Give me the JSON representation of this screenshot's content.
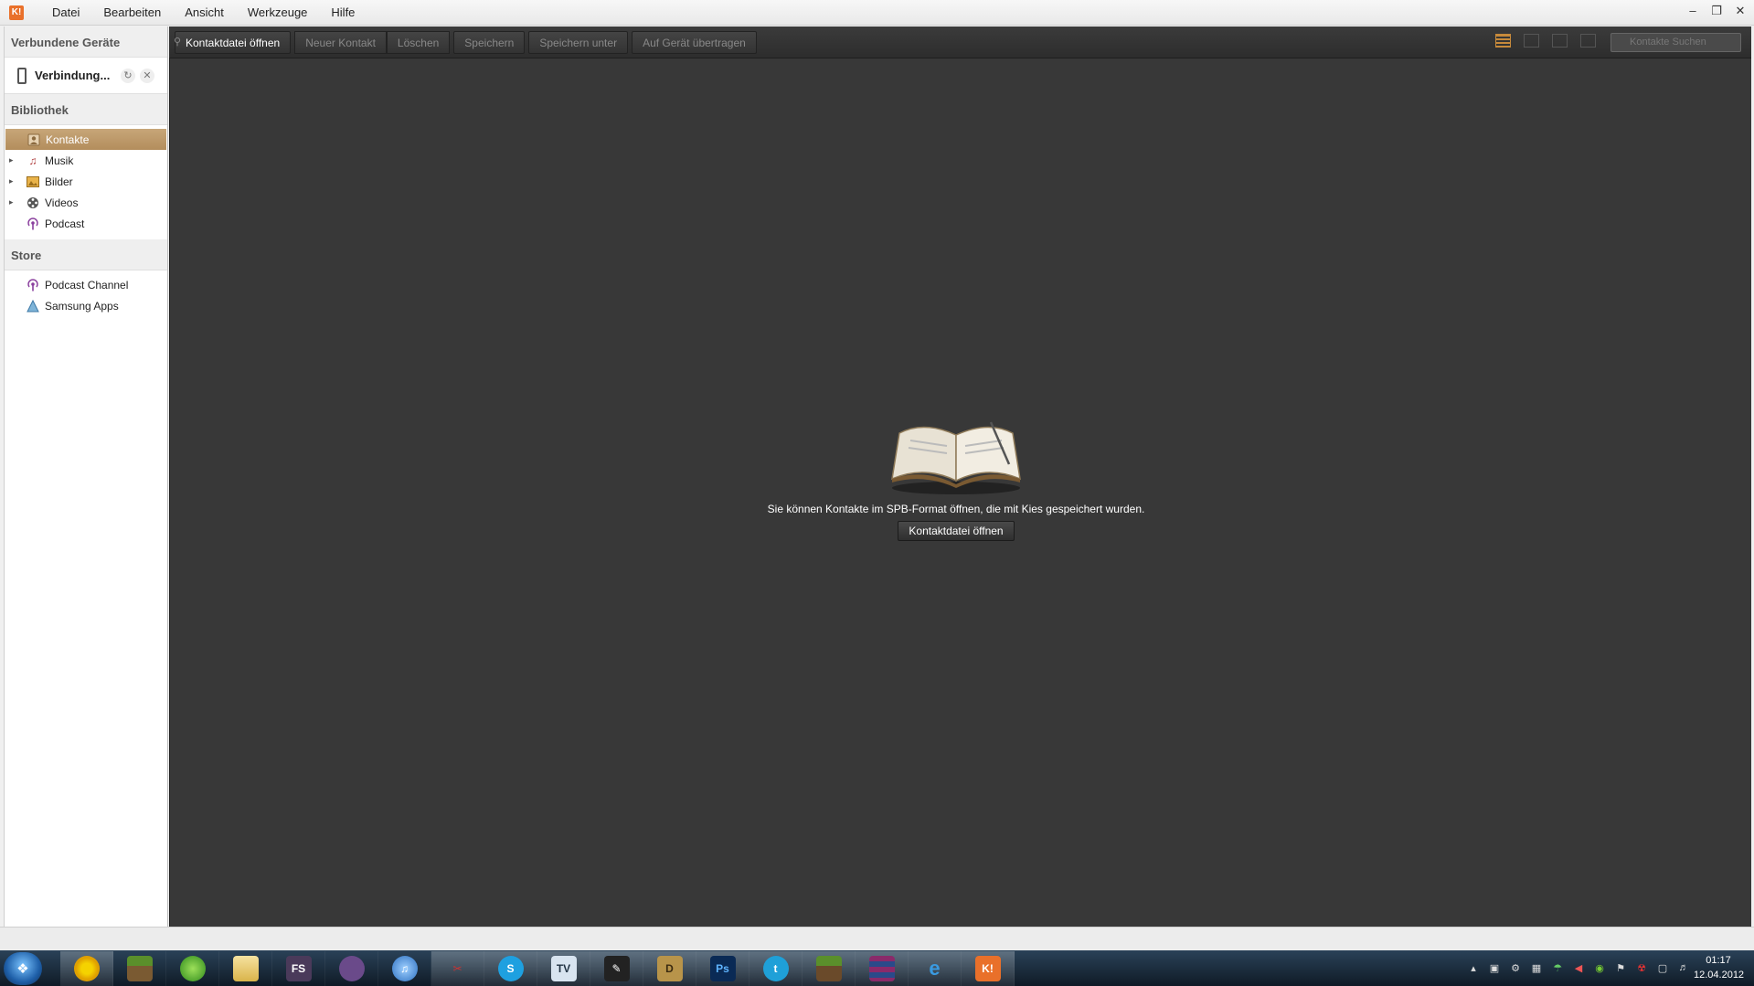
{
  "app": {
    "logo_text": "K!",
    "menu": [
      "Datei",
      "Bearbeiten",
      "Ansicht",
      "Werkzeuge",
      "Hilfe"
    ],
    "window_controls": [
      "minimize-icon",
      "restore-icon",
      "close-icon"
    ]
  },
  "sidebar": {
    "devices_header": "Verbundene Geräte",
    "device": {
      "name": "Verbindung...",
      "icon": "phone-icon"
    },
    "library_header": "Bibliothek",
    "library_items": [
      {
        "label": "Kontakte",
        "icon": "contacts-icon",
        "expandable": false,
        "selected": true
      },
      {
        "label": "Musik",
        "icon": "music-icon",
        "expandable": true,
        "selected": false
      },
      {
        "label": "Bilder",
        "icon": "pictures-icon",
        "expandable": true,
        "selected": false
      },
      {
        "label": "Videos",
        "icon": "videos-icon",
        "expandable": true,
        "selected": false
      },
      {
        "label": "Podcast",
        "icon": "podcast-icon",
        "expandable": false,
        "selected": false
      }
    ],
    "store_header": "Store",
    "store_items": [
      {
        "label": "Podcast Channel",
        "icon": "podcast-icon"
      },
      {
        "label": "Samsung Apps",
        "icon": "samsung-apps-icon"
      }
    ]
  },
  "toolbar": {
    "open_contact_file": "Kontaktdatei öffnen",
    "new_contact": "Neuer Kontakt",
    "delete": "Löschen",
    "save": "Speichern",
    "save_as": "Speichern unter",
    "transfer_to_device": "Auf Gerät übertragen",
    "search_placeholder": "Kontakte Suchen"
  },
  "main": {
    "empty_message": "Sie können Kontakte im SPB-Format öffnen, die mit Kies gespeichert wurden.",
    "empty_button": "Kontaktdatei öffnen"
  },
  "taskbar": {
    "icons": [
      "chrome-icon",
      "minecraft-icon",
      "xbox-icon",
      "file-explorer-icon",
      "fs-icon",
      "pidgin-icon",
      "itunes-icon",
      "snipping-tool-icon",
      "skype-icon",
      "teamviewer-icon",
      "pen-tablet-icon",
      "dosbox-icon",
      "photoshop-icon",
      "twitter-icon",
      "minecraft-server-icon",
      "winrar-icon",
      "internet-explorer-icon",
      "kies-icon"
    ],
    "clock_time": "01:17",
    "clock_date": "12.04.2012"
  },
  "colors": {
    "accent_selected": "#b8915f",
    "main_background": "#383838",
    "toolbar_background": "#333333"
  }
}
